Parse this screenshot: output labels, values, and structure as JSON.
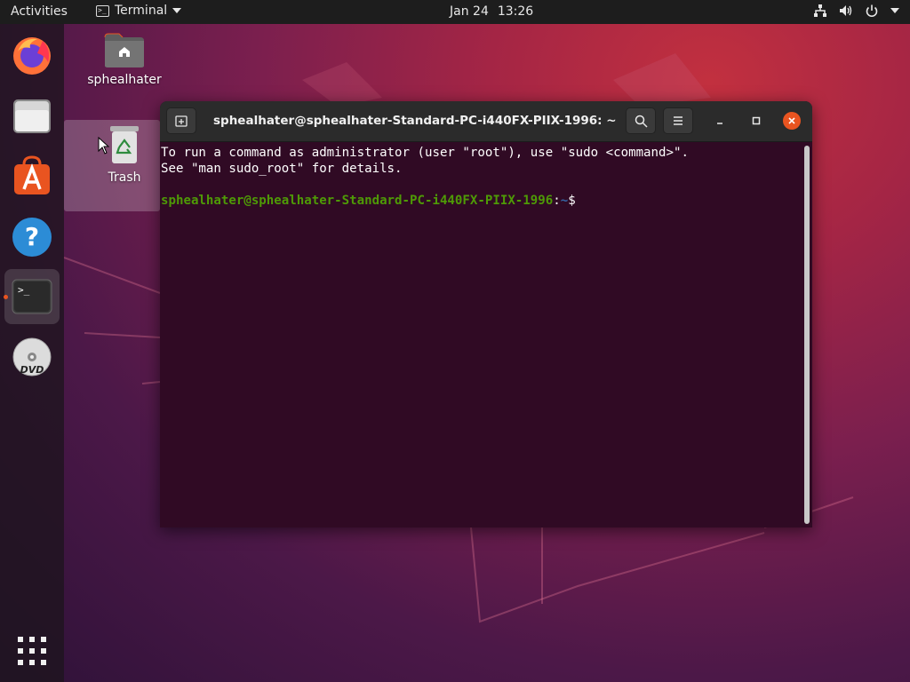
{
  "topbar": {
    "activities": "Activities",
    "app_name": "Terminal",
    "date": "Jan 24",
    "time": "13:26"
  },
  "dock": {
    "items": [
      {
        "name": "Firefox Web Browser",
        "icon": "firefox-icon"
      },
      {
        "name": "Files",
        "icon": "files-icon"
      },
      {
        "name": "Ubuntu Software",
        "icon": "software-icon"
      },
      {
        "name": "Help",
        "icon": "help-icon"
      },
      {
        "name": "Terminal",
        "icon": "terminal-icon",
        "running": true
      },
      {
        "name": "DVD",
        "icon": "dvd-icon"
      }
    ],
    "show_apps_icon": "app-grid-icon"
  },
  "desktop": {
    "home_label": "sphealhater",
    "trash_label": "Trash"
  },
  "terminal": {
    "title": "sphealhater@sphealhater-Standard-PC-i440FX-PIIX-1996: ~",
    "line1": "To run a command as administrator (user \"root\"), use \"sudo <command>\".",
    "line2": "See \"man sudo_root\" for details.",
    "prompt_user": "sphealhater@sphealhater-Standard-PC-i440FX-PIIX-1996",
    "prompt_sep": ":",
    "prompt_path": "~",
    "prompt_end": "$"
  },
  "colors": {
    "accent": "#e95420",
    "terminal_bg": "#300a24",
    "prompt_user": "#4e9a06",
    "prompt_path": "#3465a4"
  }
}
